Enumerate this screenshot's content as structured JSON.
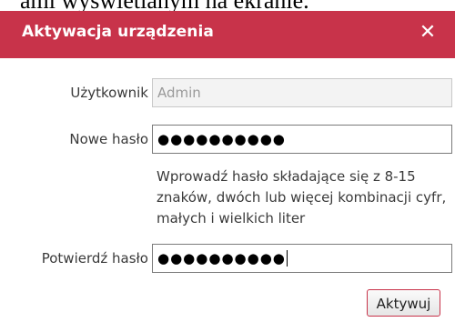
{
  "background_text": "ami wyświetlanym na ekranie.",
  "dialog": {
    "title": "Aktywacja urządzenia",
    "close_glyph": "✕",
    "titlebar_color": "#c8334a",
    "user": {
      "label": "Użytkownik",
      "value": "Admin"
    },
    "new_password": {
      "label": "Nowe hasło",
      "masked_value": "●●●●●●●●●●"
    },
    "hint": "Wprowadź hasło składające się z 8-15 znaków, dwóch lub więcej kombinacji cyfr, małych i wielkich liter",
    "confirm_password": {
      "label": "Potwierdź hasło",
      "masked_value": "●●●●●●●●●●"
    },
    "activate_button": "Aktywuj"
  }
}
